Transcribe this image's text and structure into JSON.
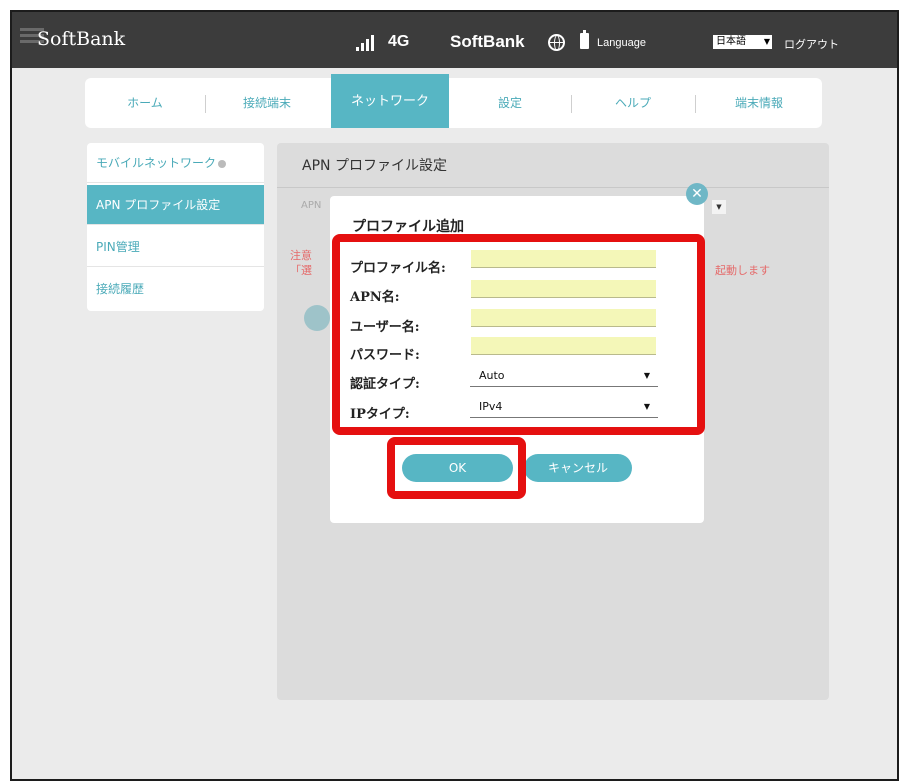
{
  "header": {
    "logo": "SoftBank",
    "network_type": "4G",
    "carrier": "SoftBank",
    "language_label": "Language",
    "language_value": "日本語",
    "logout": "ログアウト",
    "icons": [
      "signal-icon",
      "globe-icon",
      "battery-icon"
    ]
  },
  "nav": {
    "tabs": [
      {
        "label": "ホーム",
        "active": false
      },
      {
        "label": "接続端末",
        "active": false
      },
      {
        "label": "ネットワーク",
        "active": true
      },
      {
        "label": "設定",
        "active": false
      },
      {
        "label": "ヘルプ",
        "active": false
      },
      {
        "label": "端末情報",
        "active": false
      }
    ]
  },
  "sidebar": {
    "items": [
      {
        "label": "モバイルネットワーク",
        "active": false
      },
      {
        "label": "APN プロファイル設定",
        "active": true
      },
      {
        "label": "PIN管理",
        "active": false
      },
      {
        "label": "接続履歴",
        "active": false
      }
    ]
  },
  "panel": {
    "title": "APN プロファイル設定",
    "apn_label": "APN",
    "note1": "注意",
    "note2": "「選",
    "note_right": "起動します"
  },
  "modal": {
    "title": "プロファイル追加",
    "fields": {
      "profile_name": {
        "label": "プロファイル名:",
        "value": ""
      },
      "apn_name": {
        "label": "APN名:",
        "value": ""
      },
      "username": {
        "label": "ユーザー名:",
        "value": ""
      },
      "password": {
        "label": "パスワード:",
        "value": ""
      },
      "auth_type": {
        "label": "認証タイプ:",
        "value": "Auto"
      },
      "ip_type": {
        "label": "IPタイプ:",
        "value": "IPv4"
      }
    },
    "ok_label": "OK",
    "cancel_label": "キャンセル"
  },
  "colors": {
    "accent": "#57b6c4",
    "highlight": "#e51010",
    "input_bg": "#f4f7b8",
    "header_bg": "#3c3c3c"
  }
}
